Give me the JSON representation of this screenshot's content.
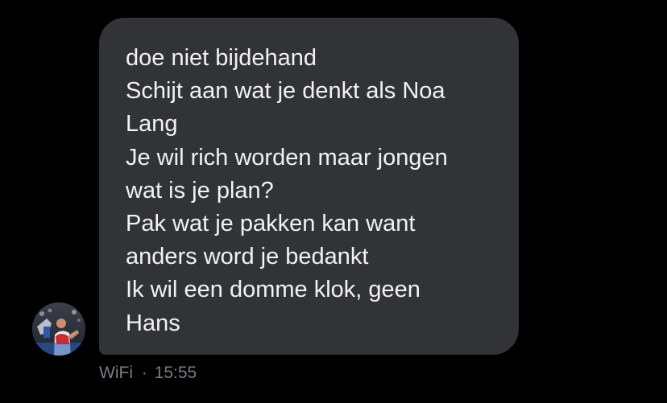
{
  "message": {
    "lines": [
      "doe niet bijdehand",
      "Schijt aan wat je denkt als Noa",
      "Lang",
      "Je wil rich worden maar jongen",
      "wat is je plan?",
      "Pak wat je pakken kan want",
      "anders word je bedankt",
      "Ik wil een domme klok, geen",
      "Hans"
    ],
    "sender": "WiFi",
    "separator": "·",
    "time": "15:55"
  },
  "colors": {
    "background": "#000000",
    "bubble": "#323336",
    "text": "#f2f2f2",
    "meta": "#7c7c80"
  },
  "icons": {
    "avatar": "user-avatar-photo"
  }
}
